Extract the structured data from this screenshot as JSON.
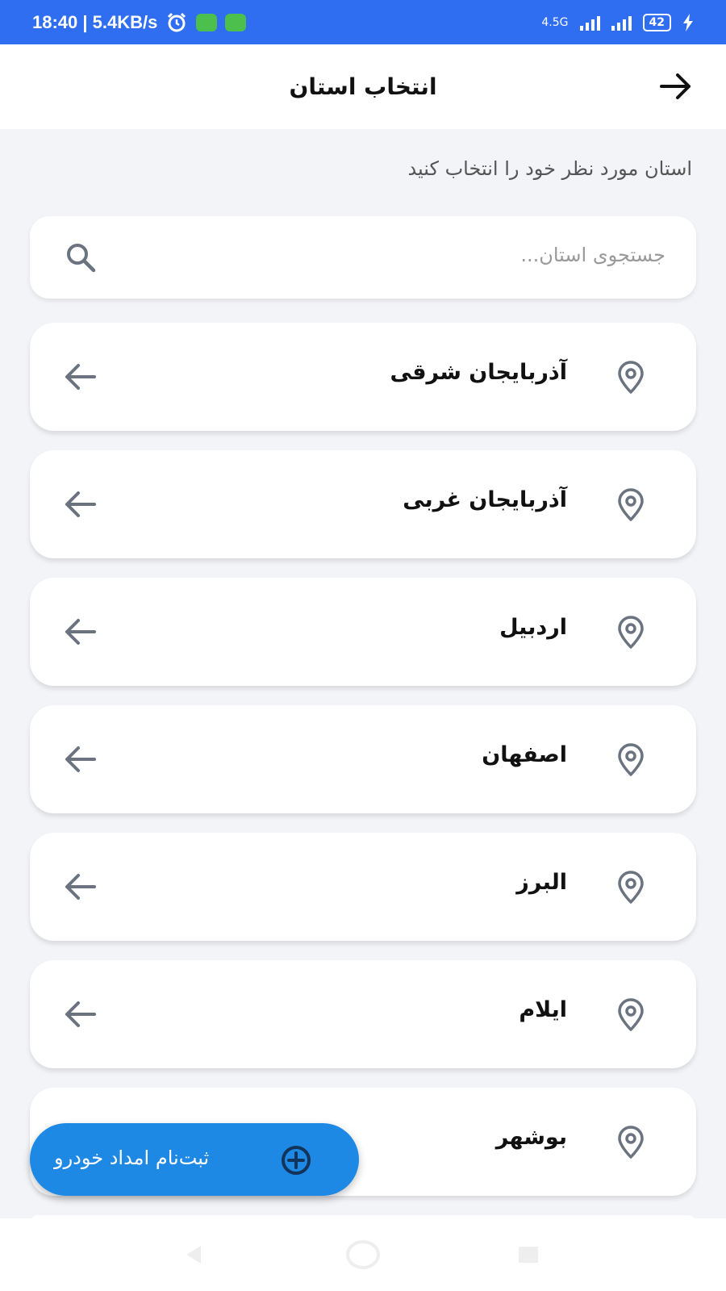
{
  "status_bar": {
    "time": "18:40 | 5.4KB/s",
    "network": "4.5G",
    "battery": "42"
  },
  "app_bar": {
    "title": "انتخاب استان"
  },
  "subtitle": "استان مورد نظر خود را انتخاب کنید",
  "search": {
    "placeholder": "جستجوی استان..."
  },
  "provinces": [
    "آذربایجان شرقی",
    "آذربایجان غربی",
    "اردبیل",
    "اصفهان",
    "البرز",
    "ایلام",
    "بوشهر"
  ],
  "fab": {
    "label": "ثبت‌نام امداد خودرو"
  },
  "colors": {
    "status_bar": "#2f6ef0",
    "fab": "#1e88e5",
    "icon_gray": "#6b7380"
  },
  "icons": [
    "back-arrow-icon",
    "search-icon",
    "location-pin-icon",
    "arrow-left-icon",
    "plus-circle-icon"
  ]
}
